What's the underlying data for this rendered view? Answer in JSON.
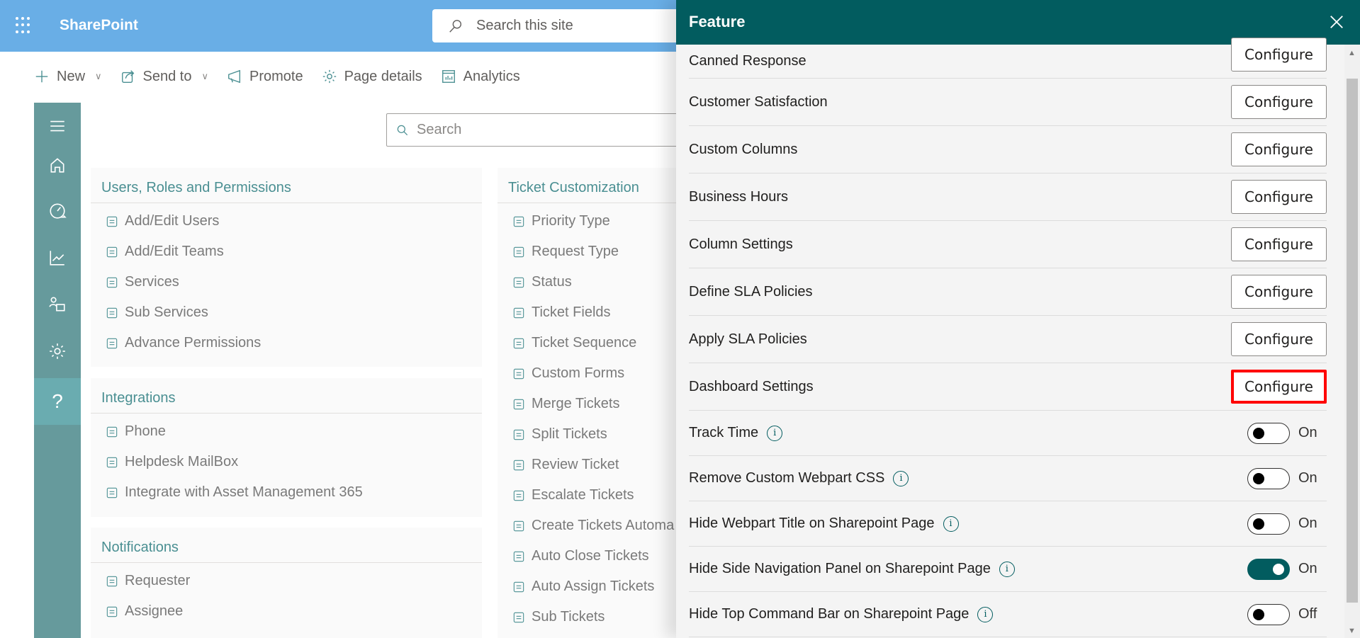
{
  "app": {
    "brand": "SharePoint",
    "site_search_placeholder": "Search this site"
  },
  "commandbar": [
    {
      "label": "New",
      "icon": "plus-icon",
      "dropdown": true
    },
    {
      "label": "Send to",
      "icon": "share-icon",
      "dropdown": true
    },
    {
      "label": "Promote",
      "icon": "megaphone-icon",
      "dropdown": false
    },
    {
      "label": "Page details",
      "icon": "gear-icon",
      "dropdown": false
    },
    {
      "label": "Analytics",
      "icon": "analytics-icon",
      "dropdown": false
    }
  ],
  "rail": [
    {
      "icon": "hamburger-icon"
    },
    {
      "icon": "home-icon"
    },
    {
      "icon": "dashboard-icon"
    },
    {
      "icon": "chart-icon"
    },
    {
      "icon": "users-icon"
    },
    {
      "icon": "settings-icon"
    },
    {
      "icon": "help-icon",
      "label": "?",
      "active": true
    }
  ],
  "main": {
    "search_placeholder": "Search",
    "sections": {
      "users": {
        "title": "Users, Roles and Permissions",
        "items": [
          "Add/Edit Users",
          "Add/Edit Teams",
          "Services",
          "Sub Services",
          "Advance Permissions"
        ]
      },
      "integrations": {
        "title": "Integrations",
        "items": [
          "Phone",
          "Helpdesk MailBox",
          "Integrate with Asset Management 365"
        ]
      },
      "notifications": {
        "title": "Notifications",
        "items": [
          "Requester",
          "Assignee"
        ]
      },
      "ticket": {
        "title": "Ticket Customization",
        "items": [
          "Priority Type",
          "Request Type",
          "Status",
          "Ticket Fields",
          "Ticket Sequence",
          "Custom Forms",
          "Merge Tickets",
          "Split Tickets",
          "Review Ticket",
          "Escalate Tickets",
          "Create Tickets Automa",
          "Auto Close Tickets",
          "Auto Assign Tickets",
          "Sub Tickets"
        ]
      }
    }
  },
  "panel": {
    "title": "Feature",
    "configure_label": "Configure",
    "configure_rows": [
      "Canned Response",
      "Customer Satisfaction",
      "Custom Columns",
      "Business Hours",
      "Column Settings",
      "Define SLA Policies",
      "Apply SLA Policies",
      "Dashboard Settings"
    ],
    "highlighted_row": "Dashboard Settings",
    "toggle_rows": [
      {
        "label": "Track Time",
        "state_label": "On",
        "checked": false
      },
      {
        "label": "Remove Custom Webpart CSS",
        "state_label": "On",
        "checked": false
      },
      {
        "label": "Hide Webpart Title on Sharepoint Page",
        "state_label": "On",
        "checked": false
      },
      {
        "label": "Hide Side Navigation Panel on Sharepoint Page",
        "state_label": "On",
        "checked": true
      },
      {
        "label": "Hide Top Command Bar on Sharepoint Page",
        "state_label": "Off",
        "checked": false
      }
    ],
    "info_glyph": "i"
  },
  "colors": {
    "topbar": "#69aee6",
    "panel_header": "#025c5f",
    "rail": "#669a9c",
    "accent_text": "#4a8f92",
    "highlight": "#ff0000"
  }
}
